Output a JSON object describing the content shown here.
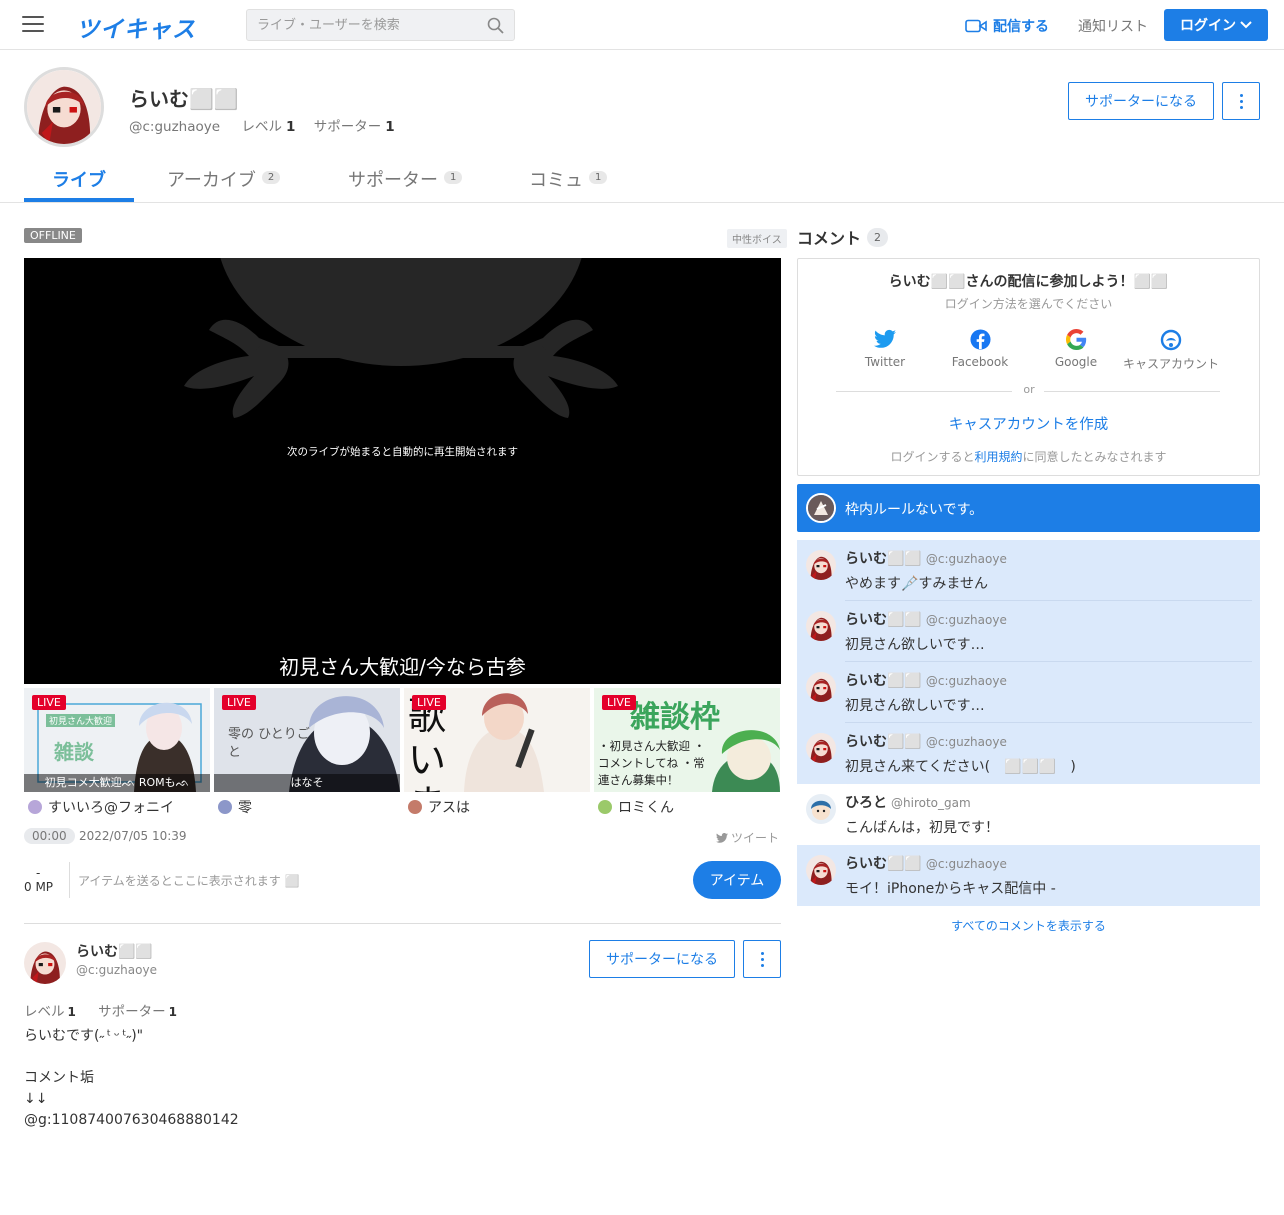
{
  "header": {
    "logo": "ツイキャス",
    "search_placeholder": "ライブ・ユーザーを検索",
    "broadcast": "配信する",
    "notifications": "通知リスト",
    "login": "ログイン"
  },
  "profile": {
    "name": "らいむ⬜⬜",
    "id": "@c:guzhaoye",
    "level_label": "レベル",
    "level": "1",
    "supporter_label": "サポーター",
    "supporter": "1",
    "support_button": "サポーターになる"
  },
  "tabs": [
    {
      "label": "ライブ",
      "count": ""
    },
    {
      "label": "アーカイブ",
      "count": "2"
    },
    {
      "label": "サポーター",
      "count": "1"
    },
    {
      "label": "コミュ",
      "count": "1"
    }
  ],
  "player": {
    "status": "OFFLINE",
    "voice_tag": "中性ボイス",
    "message": "次のライブが始まると自動的に再生開始されます",
    "title": "初見さん大歓迎/今なら古参"
  },
  "thumbnails": [
    {
      "badge": "LIVE",
      "caption": "初見コメ大歓迎ᨒ ROMもᨒ",
      "user": "すいいろ@フォニイ",
      "art_text": "雑談",
      "art_sub": "初見さん大歓迎"
    },
    {
      "badge": "LIVE",
      "caption": "はなそ",
      "user": "零",
      "art_text": "零の ひとりごと",
      "art_sub": ""
    },
    {
      "badge": "LIVE",
      "caption": "",
      "user": "アスは",
      "art_text": "歌 い ま す",
      "art_sub": ""
    },
    {
      "badge": "LIVE",
      "caption": "",
      "user": "ロミくん",
      "art_text": "雑談枠",
      "art_sub": "・初見さん大歓迎 ・コメントしてね ・常連さん募集中！"
    }
  ],
  "meta": {
    "time": "00:00",
    "date": "2022/07/05 10:39",
    "tweet": "ツイート",
    "mp_dash": "-",
    "mp": "0 MP",
    "item_hint": "アイテムを送るとここに表示されます ⬜",
    "item_button": "アイテム"
  },
  "bio": {
    "name": "らいむ⬜⬜",
    "id": "@c:guzhaoye",
    "level_label": "レベル",
    "level": "1",
    "supporter_label": "サポーター",
    "supporter": "1",
    "text": "らいむです(˶ ᵗ ᵕ ᵗ˶)\"\n\nコメント垢\n↓↓\n@g:110874007630468880142",
    "support_button": "サポーターになる"
  },
  "comments_panel": {
    "title": "コメント",
    "count": "2",
    "join_title": "らいむ⬜⬜さんの配信に参加しよう！⬜⬜",
    "join_sub": "ログイン方法を選んでください",
    "providers": [
      "Twitter",
      "Facebook",
      "Google",
      "キャスアカウント"
    ],
    "or": "or",
    "create": "キャスアカウントを作成",
    "terms_pre": "ログインすると",
    "terms_link": "利用規約",
    "terms_post": "に同意したとみなされます",
    "rule": "枠内ルールないです。",
    "show_all": "すべてのコメントを表示する"
  },
  "comments": [
    {
      "name": "らいむ⬜⬜",
      "id": "@c:guzhaoye",
      "text": "やめます🩼すみません",
      "highlight": true
    },
    {
      "name": "らいむ⬜⬜",
      "id": "@c:guzhaoye",
      "text": "初見さん欲しいです…",
      "highlight": true
    },
    {
      "name": "らいむ⬜⬜",
      "id": "@c:guzhaoye",
      "text": "初見さん欲しいです…",
      "highlight": true
    },
    {
      "name": "らいむ⬜⬜",
      "id": "@c:guzhaoye",
      "text": "初見さん来てください(　⬜⬜⬜　)",
      "highlight": true
    },
    {
      "name": "ひろと",
      "id": "@hiroto_gam",
      "text": "こんばんは，初見です！",
      "highlight": false
    },
    {
      "name": "らいむ⬜⬜",
      "id": "@c:guzhaoye",
      "text": "モイ！iPhoneからキャス配信中 -",
      "highlight": true
    }
  ],
  "colors": {
    "accent": "#1d7ee6",
    "live": "#e4002b",
    "comment_highlight": "#dbe9fb"
  }
}
